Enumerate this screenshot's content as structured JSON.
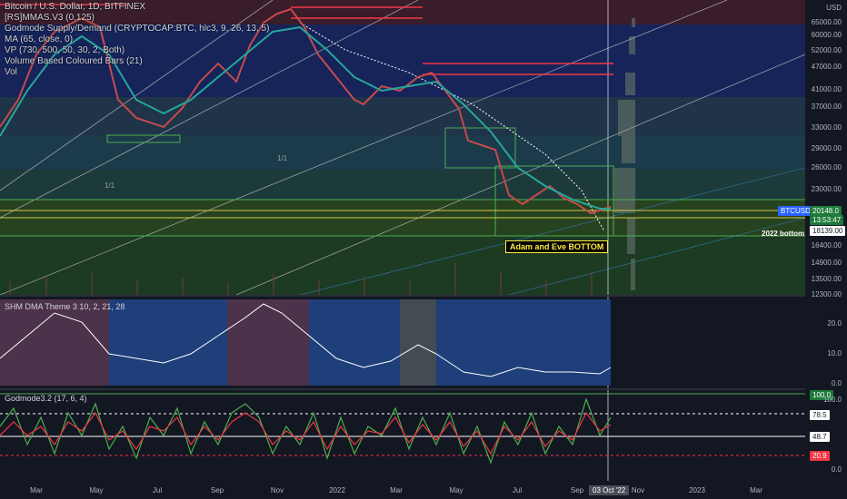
{
  "legend": {
    "symbol_line": "Bitcoin / U.S. Dollar, 1D, BITFINEX",
    "indicators": [
      "[RS]MMAS.V3 (0.125)",
      "Godmode Supply/Demand (CRYPTOCAP:BTC, hlc3, 9, 26, 13, 5)",
      "MA (65, close, 0)",
      "VP (730, 500, 50, 30, 2, Both)",
      "Volume Based Coloured Bars (21)",
      "Vol"
    ]
  },
  "price_axis": {
    "currency": "USD",
    "ticks": [
      "65000.00",
      "60000.00",
      "52000.00",
      "47000.00",
      "41000.00",
      "37000.00",
      "33000.00",
      "29000.00",
      "26000.00",
      "23000.00",
      "18139.00",
      "16400.00",
      "14900.00",
      "13500.00",
      "12300.00"
    ],
    "labels": {
      "btcusd": "BTCUSD",
      "last_price": "20148.0",
      "countdown": "13:53:47"
    }
  },
  "annotations": {
    "bottom_2022": "2022 bottom",
    "adam_eve": "Adam and Eve BOTTOM",
    "fib_1": "1/1",
    "fib_2": "1/1"
  },
  "pane2": {
    "title": "SHM DMA Theme 3 10, 2, 21, 28",
    "ticks": [
      "20.0",
      "10.0",
      "0.0"
    ]
  },
  "pane3": {
    "title": "Godmode3.2 (17, 6, 4)",
    "ticks": [
      "100.0",
      "78.5",
      "48.7",
      "20.9",
      "0.0"
    ],
    "markers": {
      "top": "100.0",
      "upper": "78.5",
      "mid": "48.7",
      "low": "20.9"
    }
  },
  "time_axis": {
    "labels": [
      "Mar",
      "May",
      "Jul",
      "Sep",
      "Nov",
      "2022",
      "Mar",
      "May",
      "Jul",
      "Sep",
      "Nov",
      "2023",
      "Mar"
    ],
    "current_date": "03 Oct '22"
  },
  "colors": {
    "background": "#131722",
    "green_zone": "#4caf50",
    "red_line": "#f23645",
    "blue_band": "#1e3a8a",
    "btcusd_badge": "#2962ff"
  }
}
